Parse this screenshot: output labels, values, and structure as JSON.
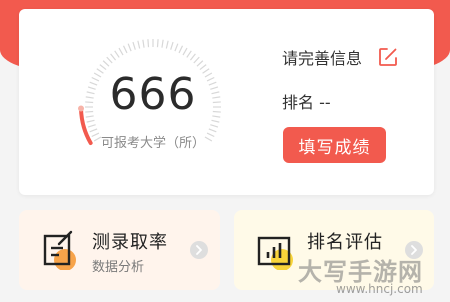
{
  "colors": {
    "accent": "#f25a4e",
    "gauge_track": "#d8d8d8",
    "score_text": "#2b2b2b",
    "card_left_bg": "#fff4ec",
    "card_right_bg": "#fffae8",
    "icon_orange": "#f7a34a",
    "icon_yellow": "#f8d43a"
  },
  "score_panel": {
    "score": "666",
    "caption": "可报考大学（所）",
    "gauge_fill_fraction": 0.12
  },
  "profile": {
    "complete_info_label": "请完善信息",
    "edit_icon": "edit-icon",
    "rank_label": "排名 --",
    "fill_scores_button": "填写成绩"
  },
  "features": [
    {
      "title": "测录取率",
      "subtitle": "数据分析",
      "icon": "document-edit-icon"
    },
    {
      "title": "排名评估",
      "subtitle": "",
      "icon": "bar-chart-icon"
    }
  ],
  "watermark": {
    "text": "大写手游网",
    "url": "www.hncj.com"
  }
}
